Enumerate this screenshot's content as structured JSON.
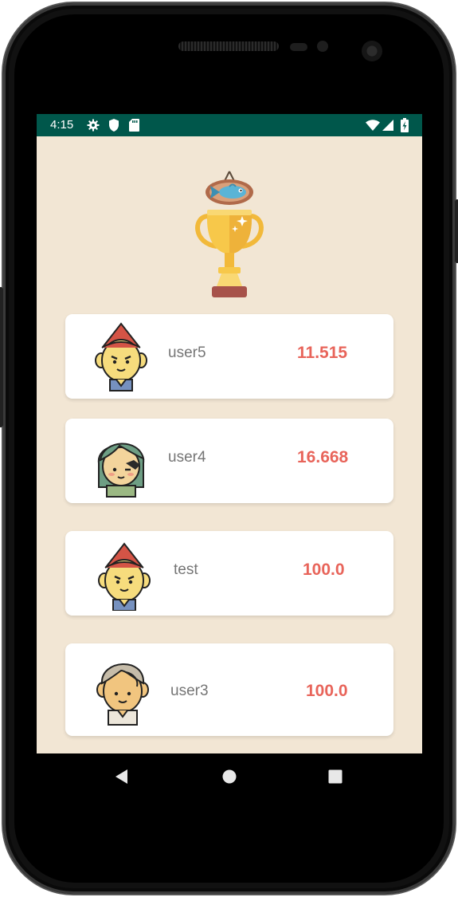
{
  "status_bar": {
    "time": "4:15",
    "left_icons": [
      "gear-icon",
      "shield-icon",
      "sd-card-icon"
    ],
    "right_icons": [
      "wifi-icon",
      "signal-icon",
      "battery-icon"
    ],
    "color": "#00574b"
  },
  "header": {
    "icon": "trophy-icon",
    "badge_icon": "fish-icon"
  },
  "leaderboard": {
    "entries": [
      {
        "avatar": "red-hood-gnome-avatar",
        "name": "user5",
        "score": "11.515"
      },
      {
        "avatar": "green-hair-avatar",
        "name": "user4",
        "score": "16.668"
      },
      {
        "avatar": "red-hood-gnome-avatar",
        "name": "test",
        "score": "100.0"
      },
      {
        "avatar": "grey-hair-avatar",
        "name": "user3",
        "score": "100.0"
      }
    ],
    "score_color": "#e8645a",
    "background": "#f2e6d4"
  },
  "nav_bar": {
    "buttons": [
      "back-icon",
      "home-icon",
      "recents-icon"
    ]
  }
}
